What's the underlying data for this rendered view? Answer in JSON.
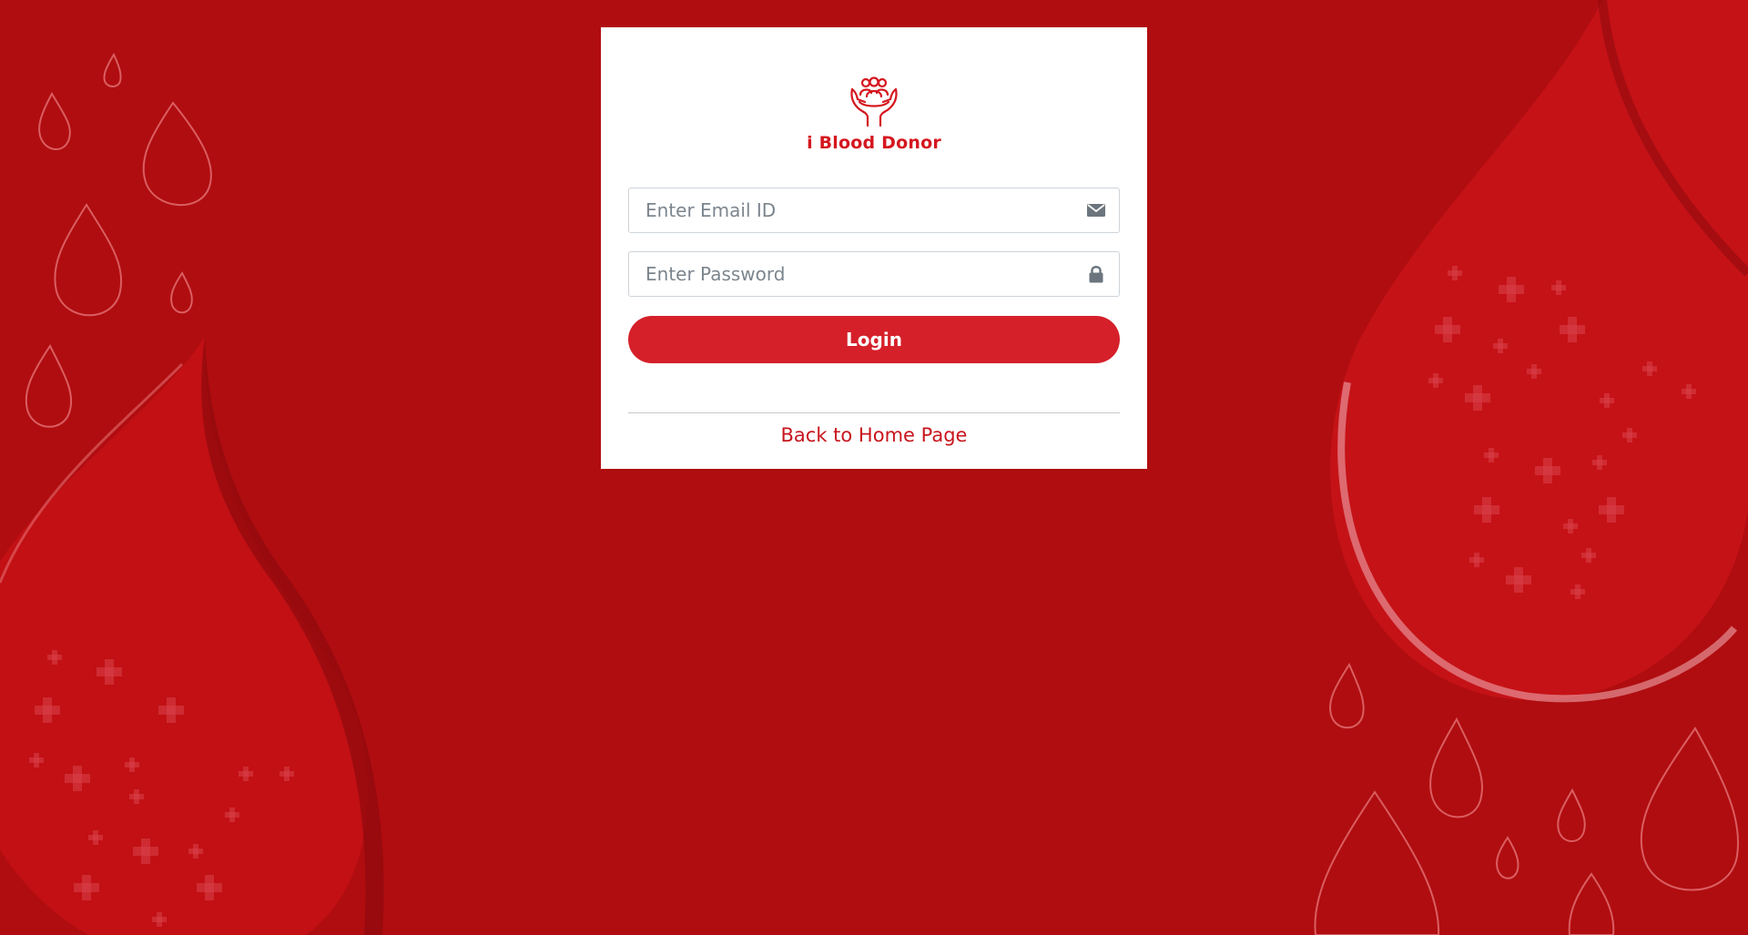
{
  "brand": {
    "name": "i Blood Donor",
    "logo_icon": "hands-holding-people-icon",
    "color": "#d5161f"
  },
  "login_form": {
    "email_placeholder": "Enter Email ID",
    "email_value": "",
    "email_icon": "envelope-icon",
    "password_placeholder": "Enter Password",
    "password_value": "",
    "password_icon": "lock-icon",
    "login_label": "Login",
    "back_link_label": "Back to Home Page"
  },
  "theme": {
    "background": "#b00d10",
    "button": "#d5202a",
    "link": "#c8151d"
  }
}
